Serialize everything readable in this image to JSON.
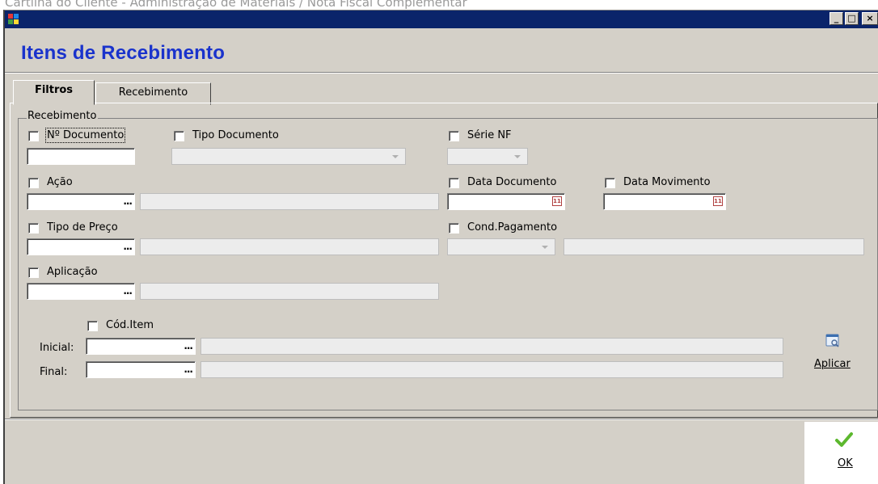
{
  "window": {
    "caption": "Cartilha do Cliente - Administração de Materiais / Nota Fiscal Complementar",
    "minimize": "_",
    "maximize": "□",
    "close": "×"
  },
  "page_title": "Itens de Recebimento",
  "tabs": [
    {
      "label": "Filtros",
      "active": true
    },
    {
      "label": "Recebimento",
      "active": false
    }
  ],
  "group": {
    "label": "Recebimento",
    "fields": {
      "documento": {
        "label": "Nº Documento",
        "checked": false,
        "value": ""
      },
      "tipo_documento": {
        "label": "Tipo Documento",
        "checked": false,
        "value": ""
      },
      "serie_nf": {
        "label": "Série NF",
        "checked": false,
        "value": ""
      },
      "acao": {
        "label": "Ação",
        "checked": false,
        "value": "",
        "lookup": "..."
      },
      "data_documento": {
        "label": "Data Documento",
        "checked": false,
        "value": ""
      },
      "data_movimento": {
        "label": "Data Movimento",
        "checked": false,
        "value": ""
      },
      "tipo_preco": {
        "label": "Tipo de Preço",
        "checked": false,
        "value": "",
        "lookup": "..."
      },
      "cond_pagamento": {
        "label": "Cond.Pagamento",
        "checked": false,
        "value": ""
      },
      "aplicacao": {
        "label": "Aplicação",
        "checked": false,
        "value": "",
        "lookup": "..."
      },
      "cod_item": {
        "label": "Cód.Item",
        "checked": false,
        "inicial_label": "Inicial:",
        "final_label": "Final:",
        "lookup": "..."
      }
    }
  },
  "buttons": {
    "aplicar": "Aplicar",
    "ok": "OK"
  },
  "colors": {
    "title_bar": "#0a246a",
    "title_text": "#1a33cc",
    "window_bg": "#d4d0c8",
    "ok_check": "#5cb82e"
  }
}
